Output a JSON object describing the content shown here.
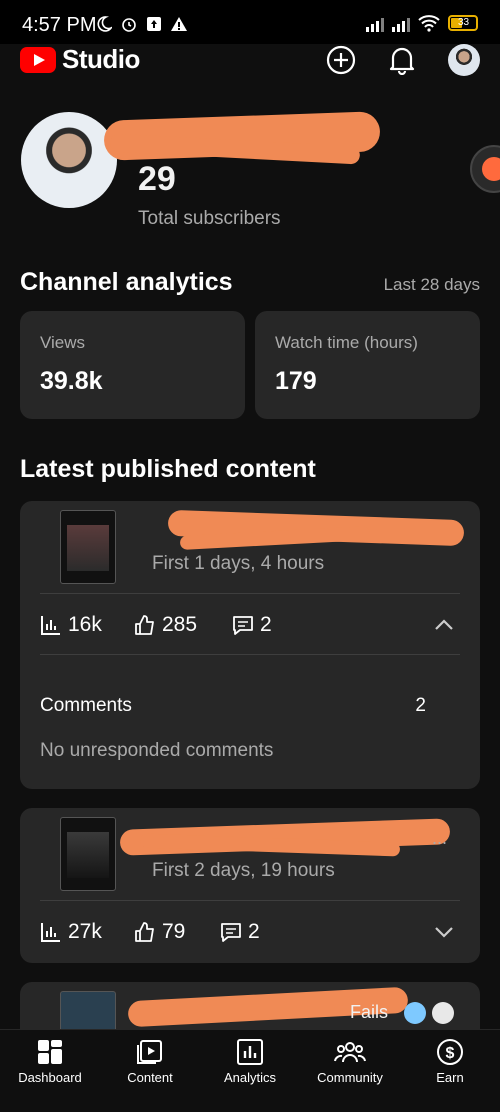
{
  "status": {
    "time": "4:57 PM",
    "battery": "33"
  },
  "header": {
    "logo_text": "Studio"
  },
  "profile": {
    "subscriber_count": "29",
    "subscriber_label": "Total subscribers"
  },
  "analytics": {
    "title": "Channel analytics",
    "range": "Last 28 days",
    "views_label": "Views",
    "views_value": "39.8k",
    "watch_label": "Watch time (hours)",
    "watch_value": "179"
  },
  "latest": {
    "title": "Latest published content",
    "items": [
      {
        "subtitle": "First 1 days, 4 hours",
        "views": "16k",
        "likes": "285",
        "comments": "2",
        "comments_label": "Comments",
        "comments_count": "2",
        "no_unresponded": "No unresponded comments"
      },
      {
        "title_visible": "...",
        "subtitle": "First 2 days, 19 hours",
        "views": "27k",
        "likes": "79",
        "comments": "2"
      },
      {
        "title_visible": "Fails"
      }
    ]
  },
  "nav": {
    "dashboard": "Dashboard",
    "content": "Content",
    "analytics": "Analytics",
    "community": "Community",
    "earn": "Earn"
  },
  "colors": {
    "background": "#0f0f0f",
    "card": "#272727",
    "brand_red": "#ff0000",
    "redaction": "#f08a55"
  },
  "icons": [
    "youtube-logo-icon",
    "create-icon",
    "notifications-icon",
    "account-avatar",
    "views-bars-icon",
    "like-icon",
    "comment-icon",
    "chevron-up-icon",
    "chevron-down-icon",
    "dashboard-icon",
    "content-icon",
    "analytics-icon",
    "community-icon",
    "earn-icon"
  ]
}
